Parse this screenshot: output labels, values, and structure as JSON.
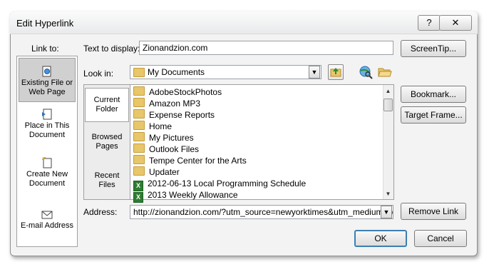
{
  "dialog": {
    "title": "Edit Hyperlink",
    "help_glyph": "?",
    "close_glyph": "✕"
  },
  "link_to": {
    "label": "Link to:",
    "items": [
      {
        "label1": "Existing File or",
        "label2": "Web Page",
        "icon": "web-page-icon"
      },
      {
        "label1": "Place in This",
        "label2": "Document",
        "icon": "document-place-icon"
      },
      {
        "label1": "Create New",
        "label2": "Document",
        "icon": "new-document-icon"
      },
      {
        "label1": "E-mail Address",
        "label2": "",
        "icon": "email-icon"
      }
    ]
  },
  "text_to_display": {
    "label": "Text to display:",
    "value": "Zionandzion.com"
  },
  "look_in": {
    "label": "Look in:",
    "value": "My Documents"
  },
  "places": [
    {
      "label1": "Current",
      "label2": "Folder"
    },
    {
      "label1": "Browsed",
      "label2": "Pages"
    },
    {
      "label1": "Recent",
      "label2": "Files"
    }
  ],
  "files": [
    {
      "name": "AdobeStockPhotos",
      "type": "folder"
    },
    {
      "name": "Amazon MP3",
      "type": "folder"
    },
    {
      "name": "Expense Reports",
      "type": "folder"
    },
    {
      "name": "Home",
      "type": "folder"
    },
    {
      "name": "My Pictures",
      "type": "folder"
    },
    {
      "name": "Outlook Files",
      "type": "folder"
    },
    {
      "name": "Tempe Center for the Arts",
      "type": "folder"
    },
    {
      "name": "Updater",
      "type": "folder"
    },
    {
      "name": "2012-06-13 Local Programming Schedule",
      "type": "excel"
    },
    {
      "name": "2013 Weekly Allowance",
      "type": "excel"
    }
  ],
  "address": {
    "label": "Address:",
    "value": "http://zionandzion.com/?utm_source=newyorktimes&utm_medium=pr&u"
  },
  "buttons": {
    "screentip": "ScreenTip...",
    "bookmark": "Bookmark...",
    "target_frame": "Target Frame...",
    "remove_link": "Remove Link",
    "ok": "OK",
    "cancel": "Cancel"
  }
}
